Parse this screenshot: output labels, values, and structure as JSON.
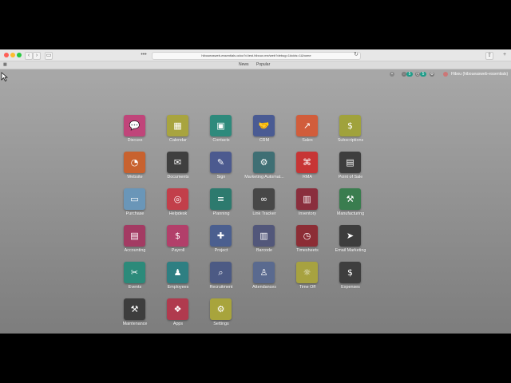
{
  "browser": {
    "url": "hiboueasweb-essentials.odoo?d.test.hiboux.me/web?debug=1#cids=1&home",
    "close_glyph": "×"
  },
  "tab_strip": {
    "menus": [
      "News",
      "Popular"
    ]
  },
  "topbar": {
    "user_name": "Hibou (hiboueasweb-essentials)",
    "badge_count": "5"
  },
  "apps": [
    {
      "label": "Discuss",
      "color": "#c0457a",
      "icon": "discuss-icon"
    },
    {
      "label": "Calendar",
      "color": "#a8a43f",
      "icon": "calendar-icon"
    },
    {
      "label": "Contacts",
      "color": "#2e8a7c",
      "icon": "contacts-icon"
    },
    {
      "label": "CRM",
      "color": "#4a5b93",
      "icon": "crm-icon"
    },
    {
      "label": "Sales",
      "color": "#d15d3b",
      "icon": "sales-icon"
    },
    {
      "label": "Subscriptions",
      "color": "#a0a23c",
      "icon": "subscriptions-icon"
    },
    {
      "label": "Website",
      "color": "#c8622f",
      "icon": "website-icon"
    },
    {
      "label": "Documents",
      "color": "#3f3f3f",
      "icon": "documents-icon"
    },
    {
      "label": "Sign",
      "color": "#4c5a8f",
      "icon": "sign-icon"
    },
    {
      "label": "Marketing Automat...",
      "color": "#3f6f74",
      "icon": "marketing-automation-icon"
    },
    {
      "label": "RMA",
      "color": "#c73535",
      "icon": "rma-icon"
    },
    {
      "label": "Point of Sale",
      "color": "#3e3e3e",
      "icon": "point-of-sale-icon"
    },
    {
      "label": "Purchase",
      "color": "#6a96b8",
      "icon": "purchase-icon"
    },
    {
      "label": "Helpdesk",
      "color": "#c23f4a",
      "icon": "helpdesk-icon"
    },
    {
      "label": "Planning",
      "color": "#2d7a6e",
      "icon": "planning-icon"
    },
    {
      "label": "Link Tracker",
      "color": "#474747",
      "icon": "link-tracker-icon"
    },
    {
      "label": "Inventory",
      "color": "#8a2e3d",
      "icon": "inventory-icon"
    },
    {
      "label": "Manufacturing",
      "color": "#3a7d4f",
      "icon": "manufacturing-icon"
    },
    {
      "label": "Accounting",
      "color": "#a33b63",
      "icon": "accounting-icon"
    },
    {
      "label": "Payroll",
      "color": "#b23f6a",
      "icon": "payroll-icon"
    },
    {
      "label": "Project",
      "color": "#4b5f8f",
      "icon": "project-icon"
    },
    {
      "label": "Barcode",
      "color": "#52577a",
      "icon": "barcode-icon"
    },
    {
      "label": "Timesheets",
      "color": "#8c2d35",
      "icon": "timesheets-icon"
    },
    {
      "label": "Email Marketing",
      "color": "#3d3d3d",
      "icon": "email-marketing-icon"
    },
    {
      "label": "Events",
      "color": "#2c8a7a",
      "icon": "events-icon"
    },
    {
      "label": "Employees",
      "color": "#2e7f82",
      "icon": "employees-icon"
    },
    {
      "label": "Recruitment",
      "color": "#4c5a84",
      "icon": "recruitment-icon"
    },
    {
      "label": "Attendances",
      "color": "#5a6a8f",
      "icon": "attendances-icon"
    },
    {
      "label": "Time Off",
      "color": "#a7a240",
      "icon": "time-off-icon"
    },
    {
      "label": "Expenses",
      "color": "#3e3e3e",
      "icon": "expenses-icon"
    },
    {
      "label": "Maintenance",
      "color": "#3d3d3d",
      "icon": "maintenance-icon"
    },
    {
      "label": "Apps",
      "color": "#b03a4e",
      "icon": "apps-icon"
    },
    {
      "label": "Settings",
      "color": "#a8a43c",
      "icon": "settings-icon"
    }
  ]
}
